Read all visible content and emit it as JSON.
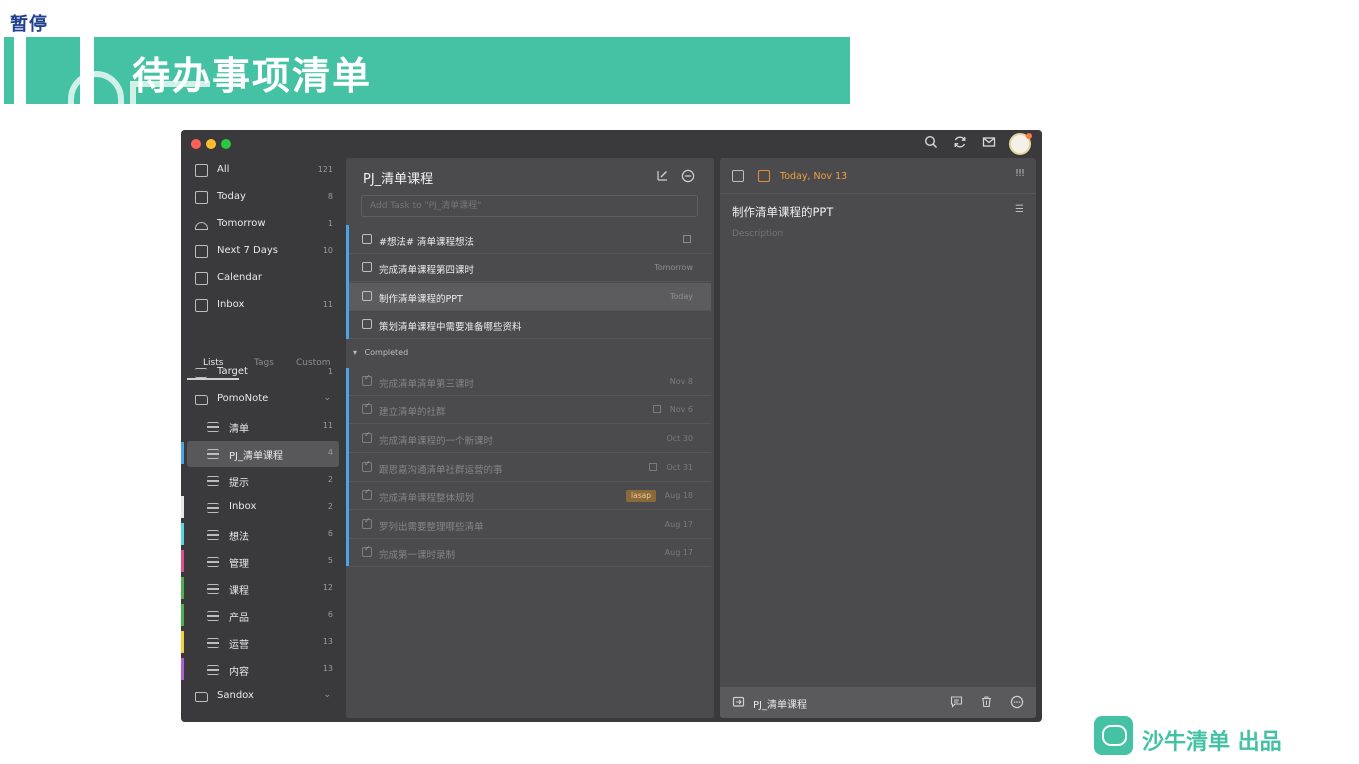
{
  "overlay": {
    "pause_label": "暂停"
  },
  "banner": {
    "title": "待办事项清单"
  },
  "window": {
    "colors": {
      "accent_blue": "#4ba4e6",
      "date_orange": "#f0a040"
    }
  },
  "sidebar": {
    "smart_lists": [
      {
        "label": "All",
        "count": "121"
      },
      {
        "label": "Today",
        "count": "8"
      },
      {
        "label": "Tomorrow",
        "count": "1"
      },
      {
        "label": "Next 7 Days",
        "count": "10"
      },
      {
        "label": "Calendar",
        "count": ""
      },
      {
        "label": "Inbox",
        "count": "11"
      }
    ],
    "tabs": [
      "Lists",
      "Tags",
      "Custom"
    ],
    "lists": [
      {
        "label": "Target",
        "count": "1"
      },
      {
        "label": "PomoNote",
        "count": ""
      },
      {
        "label": "清单",
        "count": "11"
      },
      {
        "label": "PJ_清单课程",
        "count": "4"
      },
      {
        "label": "提示",
        "count": "2"
      },
      {
        "label": "Inbox",
        "count": "2"
      },
      {
        "label": "想法",
        "count": "6"
      },
      {
        "label": "管理",
        "count": "5"
      },
      {
        "label": "课程",
        "count": "12"
      },
      {
        "label": "产品",
        "count": "6"
      },
      {
        "label": "运营",
        "count": "13"
      },
      {
        "label": "内容",
        "count": "13"
      },
      {
        "label": "Sandox",
        "count": ""
      }
    ]
  },
  "task_list": {
    "title": "PJ_清单课程",
    "add_placeholder": "Add Task to \"PJ_清单课程\"",
    "completed_header": "Completed",
    "tasks": [
      {
        "title": "#想法# 清单课程想法",
        "date": ""
      },
      {
        "title": "完成清单课程第四课时",
        "date": "Tomorrow"
      },
      {
        "title": "制作清单课程的PPT",
        "date": "Today"
      },
      {
        "title": "策划清单课程中需要准备哪些资料",
        "date": ""
      }
    ],
    "completed": [
      {
        "title": "完成清单清单第三课时",
        "date": "Nov 8",
        "tag": ""
      },
      {
        "title": "建立清单的社群",
        "date": "Nov 6",
        "tag": ""
      },
      {
        "title": "完成清单课程的一个新课时",
        "date": "Oct 30",
        "tag": ""
      },
      {
        "title": "跟思嘉沟通清单社群运营的事",
        "date": "Oct 31",
        "tag": ""
      },
      {
        "title": "完成清单课程整体规划",
        "date": "Aug 18",
        "tag": "lasap"
      },
      {
        "title": "罗列出需要整理哪些清单",
        "date": "Aug 17",
        "tag": ""
      },
      {
        "title": "完成第一课时录制",
        "date": "Aug 17",
        "tag": ""
      }
    ]
  },
  "detail": {
    "date": "Today, Nov 13",
    "title": "制作清单课程的PPT",
    "description_placeholder": "Description",
    "footer_list": "PJ_清单课程"
  },
  "brand": {
    "text": "沙牛清单 出品",
    "color": "#45c1a4"
  }
}
